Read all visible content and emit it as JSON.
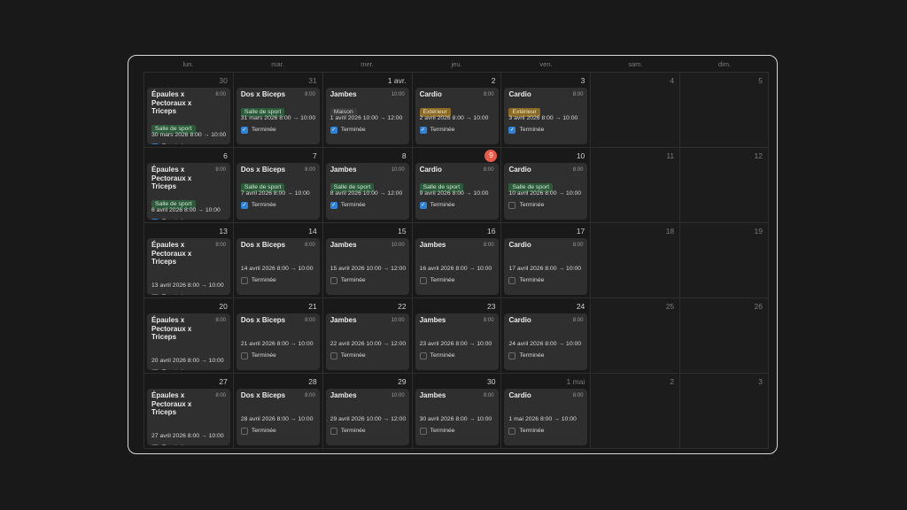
{
  "weekdays": [
    "lun.",
    "mar.",
    "mer.",
    "jeu.",
    "ven.",
    "sam.",
    "dim."
  ],
  "colors": {
    "today": "#eb5a46",
    "tag_green": "#2c5a3a",
    "tag_orange": "#8a6a24",
    "checkbox": "#2e83d9"
  },
  "done_label": "Terminée",
  "weeks": [
    [
      {
        "day": "30",
        "other": true,
        "event": {
          "title": "Épaules x Pectoraux x Triceps",
          "time": "8:00",
          "tag": "Salle de sport",
          "tag_color": "green",
          "date": "30 mars 2026 8:00 → 10:00",
          "done": true
        }
      },
      {
        "day": "31",
        "other": true,
        "event": {
          "title": "Dos x Biceps",
          "time": "8:00",
          "tag": "Salle de sport",
          "tag_color": "green",
          "date": "31 mars 2026 8:00 → 10:00",
          "done": true
        }
      },
      {
        "day": "1 avr.",
        "event": {
          "title": "Jambes",
          "time": "10:00",
          "tag": "Maison",
          "tag_color": "gray",
          "date": "1 avril 2026 10:00 → 12:00",
          "done": true
        }
      },
      {
        "day": "2",
        "event": {
          "title": "Cardio",
          "time": "8:00",
          "tag": "Extérieur",
          "tag_color": "orange",
          "date": "2 avril 2026 8:00 → 10:00",
          "done": true
        }
      },
      {
        "day": "3",
        "event": {
          "title": "Cardio",
          "time": "8:00",
          "tag": "Extérieur",
          "tag_color": "orange",
          "date": "3 avril 2026 8:00 → 10:00",
          "done": true
        }
      },
      {
        "day": "4",
        "weekend": true
      },
      {
        "day": "5",
        "weekend": true
      }
    ],
    [
      {
        "day": "6",
        "event": {
          "title": "Épaules x Pectoraux x Triceps",
          "time": "8:00",
          "tag": "Salle de sport",
          "tag_color": "green",
          "date": "6 avril 2026 8:00 → 10:00",
          "done": true
        }
      },
      {
        "day": "7",
        "event": {
          "title": "Dos x Biceps",
          "time": "8:00",
          "tag": "Salle de sport",
          "tag_color": "green",
          "date": "7 avril 2026 8:00 → 10:00",
          "done": true
        }
      },
      {
        "day": "8",
        "event": {
          "title": "Jambes",
          "time": "10:00",
          "tag": "Salle de sport",
          "tag_color": "green",
          "date": "8 avril 2026 10:00 → 12:00",
          "done": true
        }
      },
      {
        "day": "9",
        "today": true,
        "event": {
          "title": "Cardio",
          "time": "8:00",
          "tag": "Salle de sport",
          "tag_color": "green",
          "date": "9 avril 2026 8:00 → 10:00",
          "done": true
        }
      },
      {
        "day": "10",
        "event": {
          "title": "Cardio",
          "time": "8:00",
          "tag": "Salle de sport",
          "tag_color": "green",
          "date": "10 avril 2026 8:00 → 10:00",
          "done": false
        }
      },
      {
        "day": "11",
        "weekend": true
      },
      {
        "day": "12",
        "weekend": true
      }
    ],
    [
      {
        "day": "13",
        "event": {
          "title": "Épaules x Pectoraux x Triceps",
          "time": "8:00",
          "tag": "",
          "date": "13 avril 2026 8:00 → 10:00",
          "done": false
        }
      },
      {
        "day": "14",
        "event": {
          "title": "Dos x Biceps",
          "time": "8:00",
          "tag": "",
          "date": "14 avril 2026 8:00 → 10:00",
          "done": false
        }
      },
      {
        "day": "15",
        "event": {
          "title": "Jambes",
          "time": "10:00",
          "tag": "",
          "date": "15 avril 2026 10:00 → 12:00",
          "done": false
        }
      },
      {
        "day": "16",
        "event": {
          "title": "Jambes",
          "time": "8:00",
          "tag": "",
          "date": "16 avril 2026 8:00 → 10:00",
          "done": false
        }
      },
      {
        "day": "17",
        "event": {
          "title": "Cardio",
          "time": "8:00",
          "tag": "",
          "date": "17 avril 2026 8:00 → 10:00",
          "done": false
        }
      },
      {
        "day": "18",
        "weekend": true
      },
      {
        "day": "19",
        "weekend": true
      }
    ],
    [
      {
        "day": "20",
        "event": {
          "title": "Épaules x Pectoraux x Triceps",
          "time": "8:00",
          "tag": "",
          "date": "20 avril 2026 8:00 → 10:00",
          "done": false
        }
      },
      {
        "day": "21",
        "event": {
          "title": "Dos x Biceps",
          "time": "8:00",
          "tag": "",
          "date": "21 avril 2026 8:00 → 10:00",
          "done": false
        }
      },
      {
        "day": "22",
        "event": {
          "title": "Jambes",
          "time": "10:00",
          "tag": "",
          "date": "22 avril 2026 10:00 → 12:00",
          "done": false
        }
      },
      {
        "day": "23",
        "event": {
          "title": "Jambes",
          "time": "8:00",
          "tag": "",
          "date": "23 avril 2026 8:00 → 10:00",
          "done": false
        }
      },
      {
        "day": "24",
        "event": {
          "title": "Cardio",
          "time": "8:00",
          "tag": "",
          "date": "24 avril 2026 8:00 → 10:00",
          "done": false
        }
      },
      {
        "day": "25",
        "weekend": true
      },
      {
        "day": "26",
        "weekend": true
      }
    ],
    [
      {
        "day": "27",
        "event": {
          "title": "Épaules x Pectoraux x Triceps",
          "time": "8:00",
          "tag": "",
          "date": "27 avril 2026 8:00 → 10:00",
          "done": false
        }
      },
      {
        "day": "28",
        "event": {
          "title": "Dos x Biceps",
          "time": "8:00",
          "tag": "",
          "date": "28 avril 2026 8:00 → 10:00",
          "done": false
        }
      },
      {
        "day": "29",
        "event": {
          "title": "Jambes",
          "time": "10:00",
          "tag": "",
          "date": "29 avril 2026 10:00 → 12:00",
          "done": false
        }
      },
      {
        "day": "30",
        "event": {
          "title": "Jambes",
          "time": "8:00",
          "tag": "",
          "date": "30 avril 2026 8:00 → 10:00",
          "done": false
        }
      },
      {
        "day": "1 mai",
        "other": true,
        "event": {
          "title": "Cardio",
          "time": "8:00",
          "tag": "",
          "date": "1 mai 2026 8:00 → 10:00",
          "done": false
        }
      },
      {
        "day": "2",
        "other": true,
        "weekend": true
      },
      {
        "day": "3",
        "other": true,
        "weekend": true
      }
    ]
  ]
}
